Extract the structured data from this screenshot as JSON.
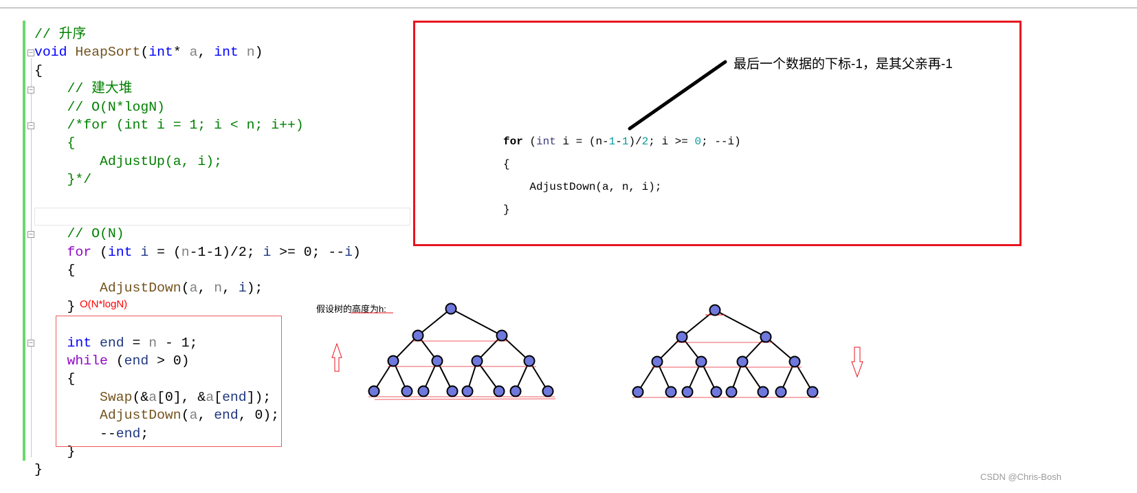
{
  "code": {
    "lines": [
      [
        [
          "// 升序",
          "cm"
        ]
      ],
      [
        [
          "void",
          "kw"
        ],
        [
          " ",
          "pl"
        ],
        [
          "HeapSort",
          "fn"
        ],
        [
          "(",
          "pl"
        ],
        [
          "int",
          "kw"
        ],
        [
          "* ",
          "pl"
        ],
        [
          "a",
          "par"
        ],
        [
          ", ",
          "pl"
        ],
        [
          "int",
          "kw"
        ],
        [
          " ",
          "pl"
        ],
        [
          "n",
          "par"
        ],
        [
          ")",
          "pl"
        ]
      ],
      [
        [
          "{",
          "pl"
        ]
      ],
      [
        [
          "    // 建大堆",
          "cm"
        ]
      ],
      [
        [
          "    // O(N*logN)",
          "cm"
        ]
      ],
      [
        [
          "    /*for (int i = 1; i < n; i++)",
          "cm"
        ]
      ],
      [
        [
          "    {",
          "cm"
        ]
      ],
      [
        [
          "        AdjustUp(a, i);",
          "cm"
        ]
      ],
      [
        [
          "    }*/",
          "cm"
        ]
      ],
      [
        [
          "",
          "pl"
        ]
      ],
      [
        [
          "",
          "pl"
        ]
      ],
      [
        [
          "    // O(N)",
          "cm"
        ]
      ],
      [
        [
          "    ",
          "pl"
        ],
        [
          "for",
          "ctl"
        ],
        [
          " (",
          "pl"
        ],
        [
          "int",
          "kw"
        ],
        [
          " ",
          "pl"
        ],
        [
          "i",
          "loc"
        ],
        [
          " = (",
          "pl"
        ],
        [
          "n",
          "par"
        ],
        [
          "-1-1)/2; ",
          "pl"
        ],
        [
          "i",
          "loc"
        ],
        [
          " >= 0; --",
          "pl"
        ],
        [
          "i",
          "loc"
        ],
        [
          ")",
          "pl"
        ]
      ],
      [
        [
          "    {",
          "pl"
        ]
      ],
      [
        [
          "        ",
          "pl"
        ],
        [
          "AdjustDown",
          "fn"
        ],
        [
          "(",
          "pl"
        ],
        [
          "a",
          "par"
        ],
        [
          ", ",
          "pl"
        ],
        [
          "n",
          "par"
        ],
        [
          ", ",
          "pl"
        ],
        [
          "i",
          "loc"
        ],
        [
          ");",
          "pl"
        ]
      ],
      [
        [
          "    }",
          "pl"
        ]
      ],
      [
        [
          "",
          "pl"
        ]
      ],
      [
        [
          "    ",
          "pl"
        ],
        [
          "int",
          "kw"
        ],
        [
          " ",
          "pl"
        ],
        [
          "end",
          "loc"
        ],
        [
          " = ",
          "pl"
        ],
        [
          "n",
          "par"
        ],
        [
          " - 1;",
          "pl"
        ]
      ],
      [
        [
          "    ",
          "pl"
        ],
        [
          "while",
          "ctl"
        ],
        [
          " (",
          "pl"
        ],
        [
          "end",
          "loc"
        ],
        [
          " > 0)",
          "pl"
        ]
      ],
      [
        [
          "    {",
          "pl"
        ]
      ],
      [
        [
          "        ",
          "pl"
        ],
        [
          "Swap",
          "fn"
        ],
        [
          "(&",
          "pl"
        ],
        [
          "a",
          "par"
        ],
        [
          "[0], &",
          "pl"
        ],
        [
          "a",
          "par"
        ],
        [
          "[",
          "pl"
        ],
        [
          "end",
          "loc"
        ],
        [
          "]);",
          "pl"
        ]
      ],
      [
        [
          "        ",
          "pl"
        ],
        [
          "AdjustDown",
          "fn"
        ],
        [
          "(",
          "pl"
        ],
        [
          "a",
          "par"
        ],
        [
          ", ",
          "pl"
        ],
        [
          "end",
          "loc"
        ],
        [
          ", 0);",
          "pl"
        ]
      ],
      [
        [
          "        --",
          "pl"
        ],
        [
          "end",
          "loc"
        ],
        [
          ";",
          "pl"
        ]
      ],
      [
        [
          "    }",
          "pl"
        ]
      ],
      [
        [
          "}",
          "pl"
        ]
      ]
    ]
  },
  "annotation_complexity": "O(N*logN)",
  "callout": {
    "note": "最后一个数据的下标-1，是其父亲再-1",
    "snippet": [
      [
        [
          "for",
          "sb"
        ],
        [
          " (",
          "sp"
        ],
        [
          "int",
          "si"
        ],
        [
          " i = (n-",
          "sp"
        ],
        [
          "1",
          "sn"
        ],
        [
          "-",
          "sp"
        ],
        [
          "1",
          "sn"
        ],
        [
          ")/",
          "sp"
        ],
        [
          "2",
          "sn"
        ],
        [
          "; i >= ",
          "sp"
        ],
        [
          "0",
          "sn"
        ],
        [
          "; --i)",
          "sp"
        ]
      ],
      [
        [
          "{",
          "sp"
        ]
      ],
      [
        [
          "    AdjustDown(a, n, i);",
          "sp"
        ]
      ],
      [
        [
          "}",
          "sp"
        ]
      ]
    ]
  },
  "tree_label": "假设树的高度为h:",
  "trees": [
    {
      "levels": 4,
      "arrow": "up"
    },
    {
      "levels": 4,
      "arrow": "down"
    }
  ],
  "colors": {
    "node_fill": "#6f78dc",
    "accent_red": "#e8141e",
    "gutter_green": "#6ad86a"
  },
  "watermark": "CSDN @Chris-Bosh"
}
